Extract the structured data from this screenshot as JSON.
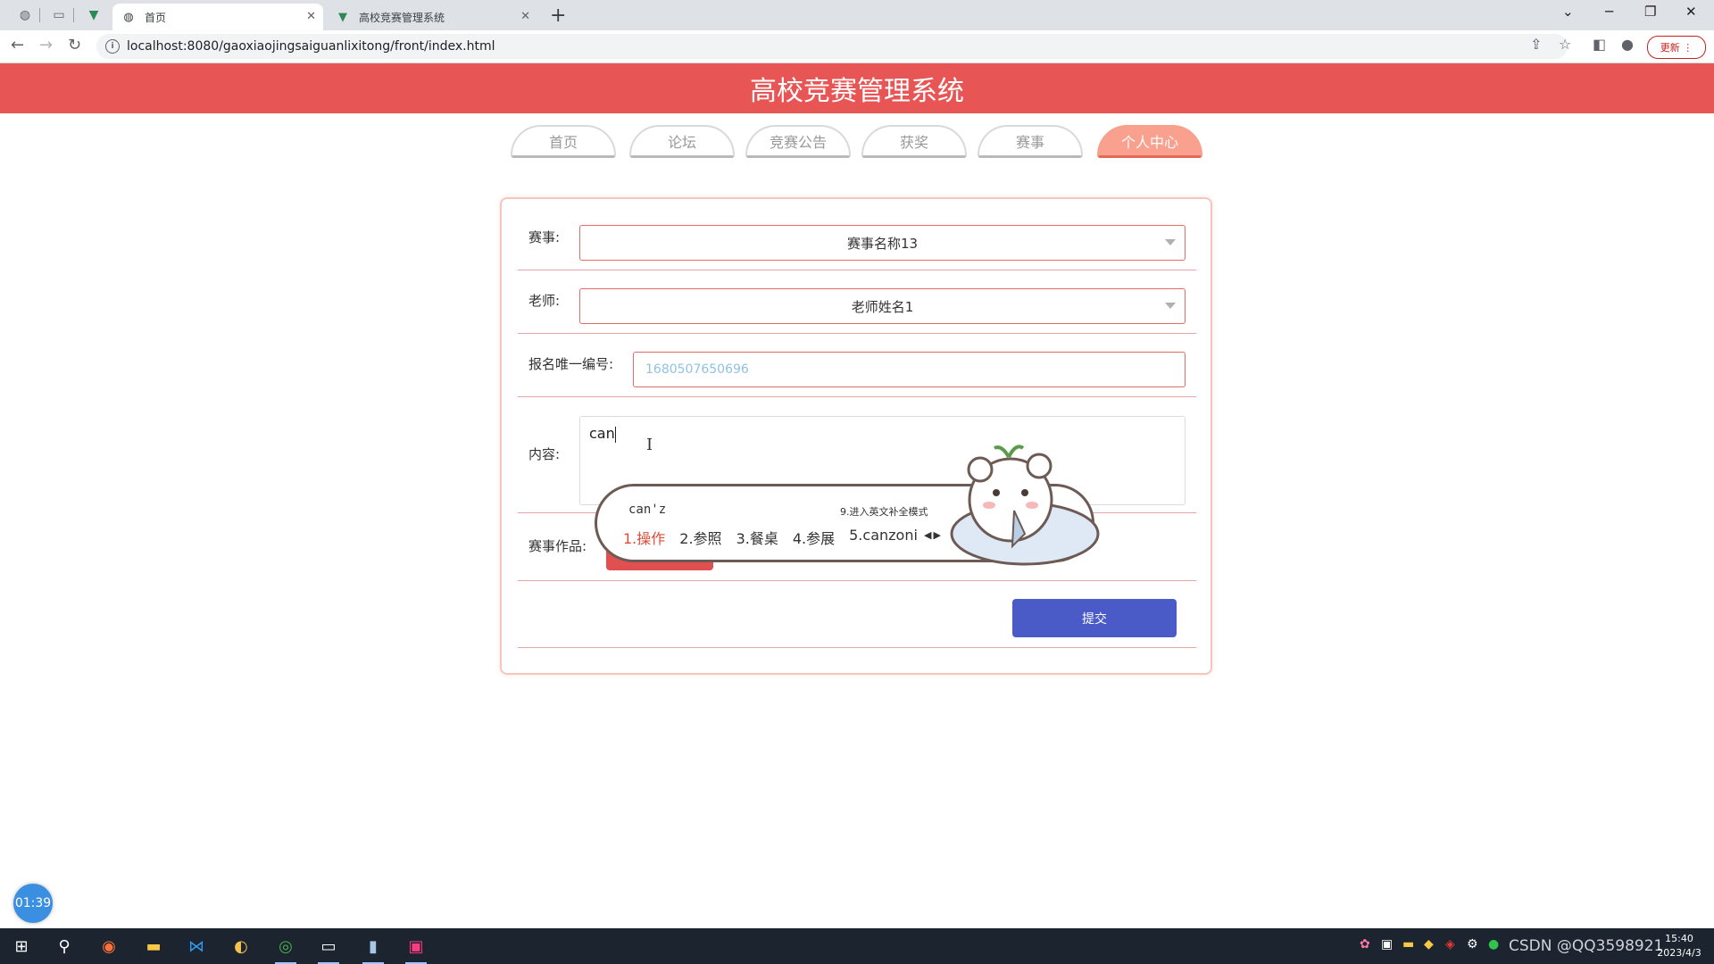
{
  "browser": {
    "tabs": [
      {
        "title": "首页",
        "active": true
      },
      {
        "title": "高校竞赛管理系统",
        "active": false
      }
    ],
    "url": "localhost:8080/gaoxiaojingsaiguanlixitong/front/index.html",
    "update_label": "更新"
  },
  "page": {
    "title": "高校竞赛管理系统",
    "nav": [
      {
        "label": "首页",
        "active": false
      },
      {
        "label": "论坛",
        "active": false
      },
      {
        "label": "竞赛公告",
        "active": false
      },
      {
        "label": "获奖",
        "active": false
      },
      {
        "label": "赛事",
        "active": false
      },
      {
        "label": "个人中心",
        "active": true
      }
    ],
    "form": {
      "event_label": "赛事:",
      "event_value": "赛事名称13",
      "teacher_label": "老师:",
      "teacher_value": "老师姓名1",
      "regid_label": "报名唯一编号:",
      "regid_value": "1680507650696",
      "content_label": "内容:",
      "content_value": "can",
      "works_label": "赛事作品:",
      "submit_label": "提交"
    }
  },
  "ime": {
    "composition": "can'z",
    "hint": "9.进入英文补全模式",
    "candidates": [
      "1.操作",
      "2.参照",
      "3.餐桌",
      "4.参展",
      "5.canzoni"
    ]
  },
  "timer": "01:39",
  "taskbar": {
    "tray_text": "CSDN @QQ3598921",
    "time": "15:40",
    "date": "2023/4/3"
  },
  "colors": {
    "header": "#e85555",
    "nav_active": "#f9a18e",
    "submit": "#4a5bc7",
    "input_border": "#e56a6a"
  }
}
